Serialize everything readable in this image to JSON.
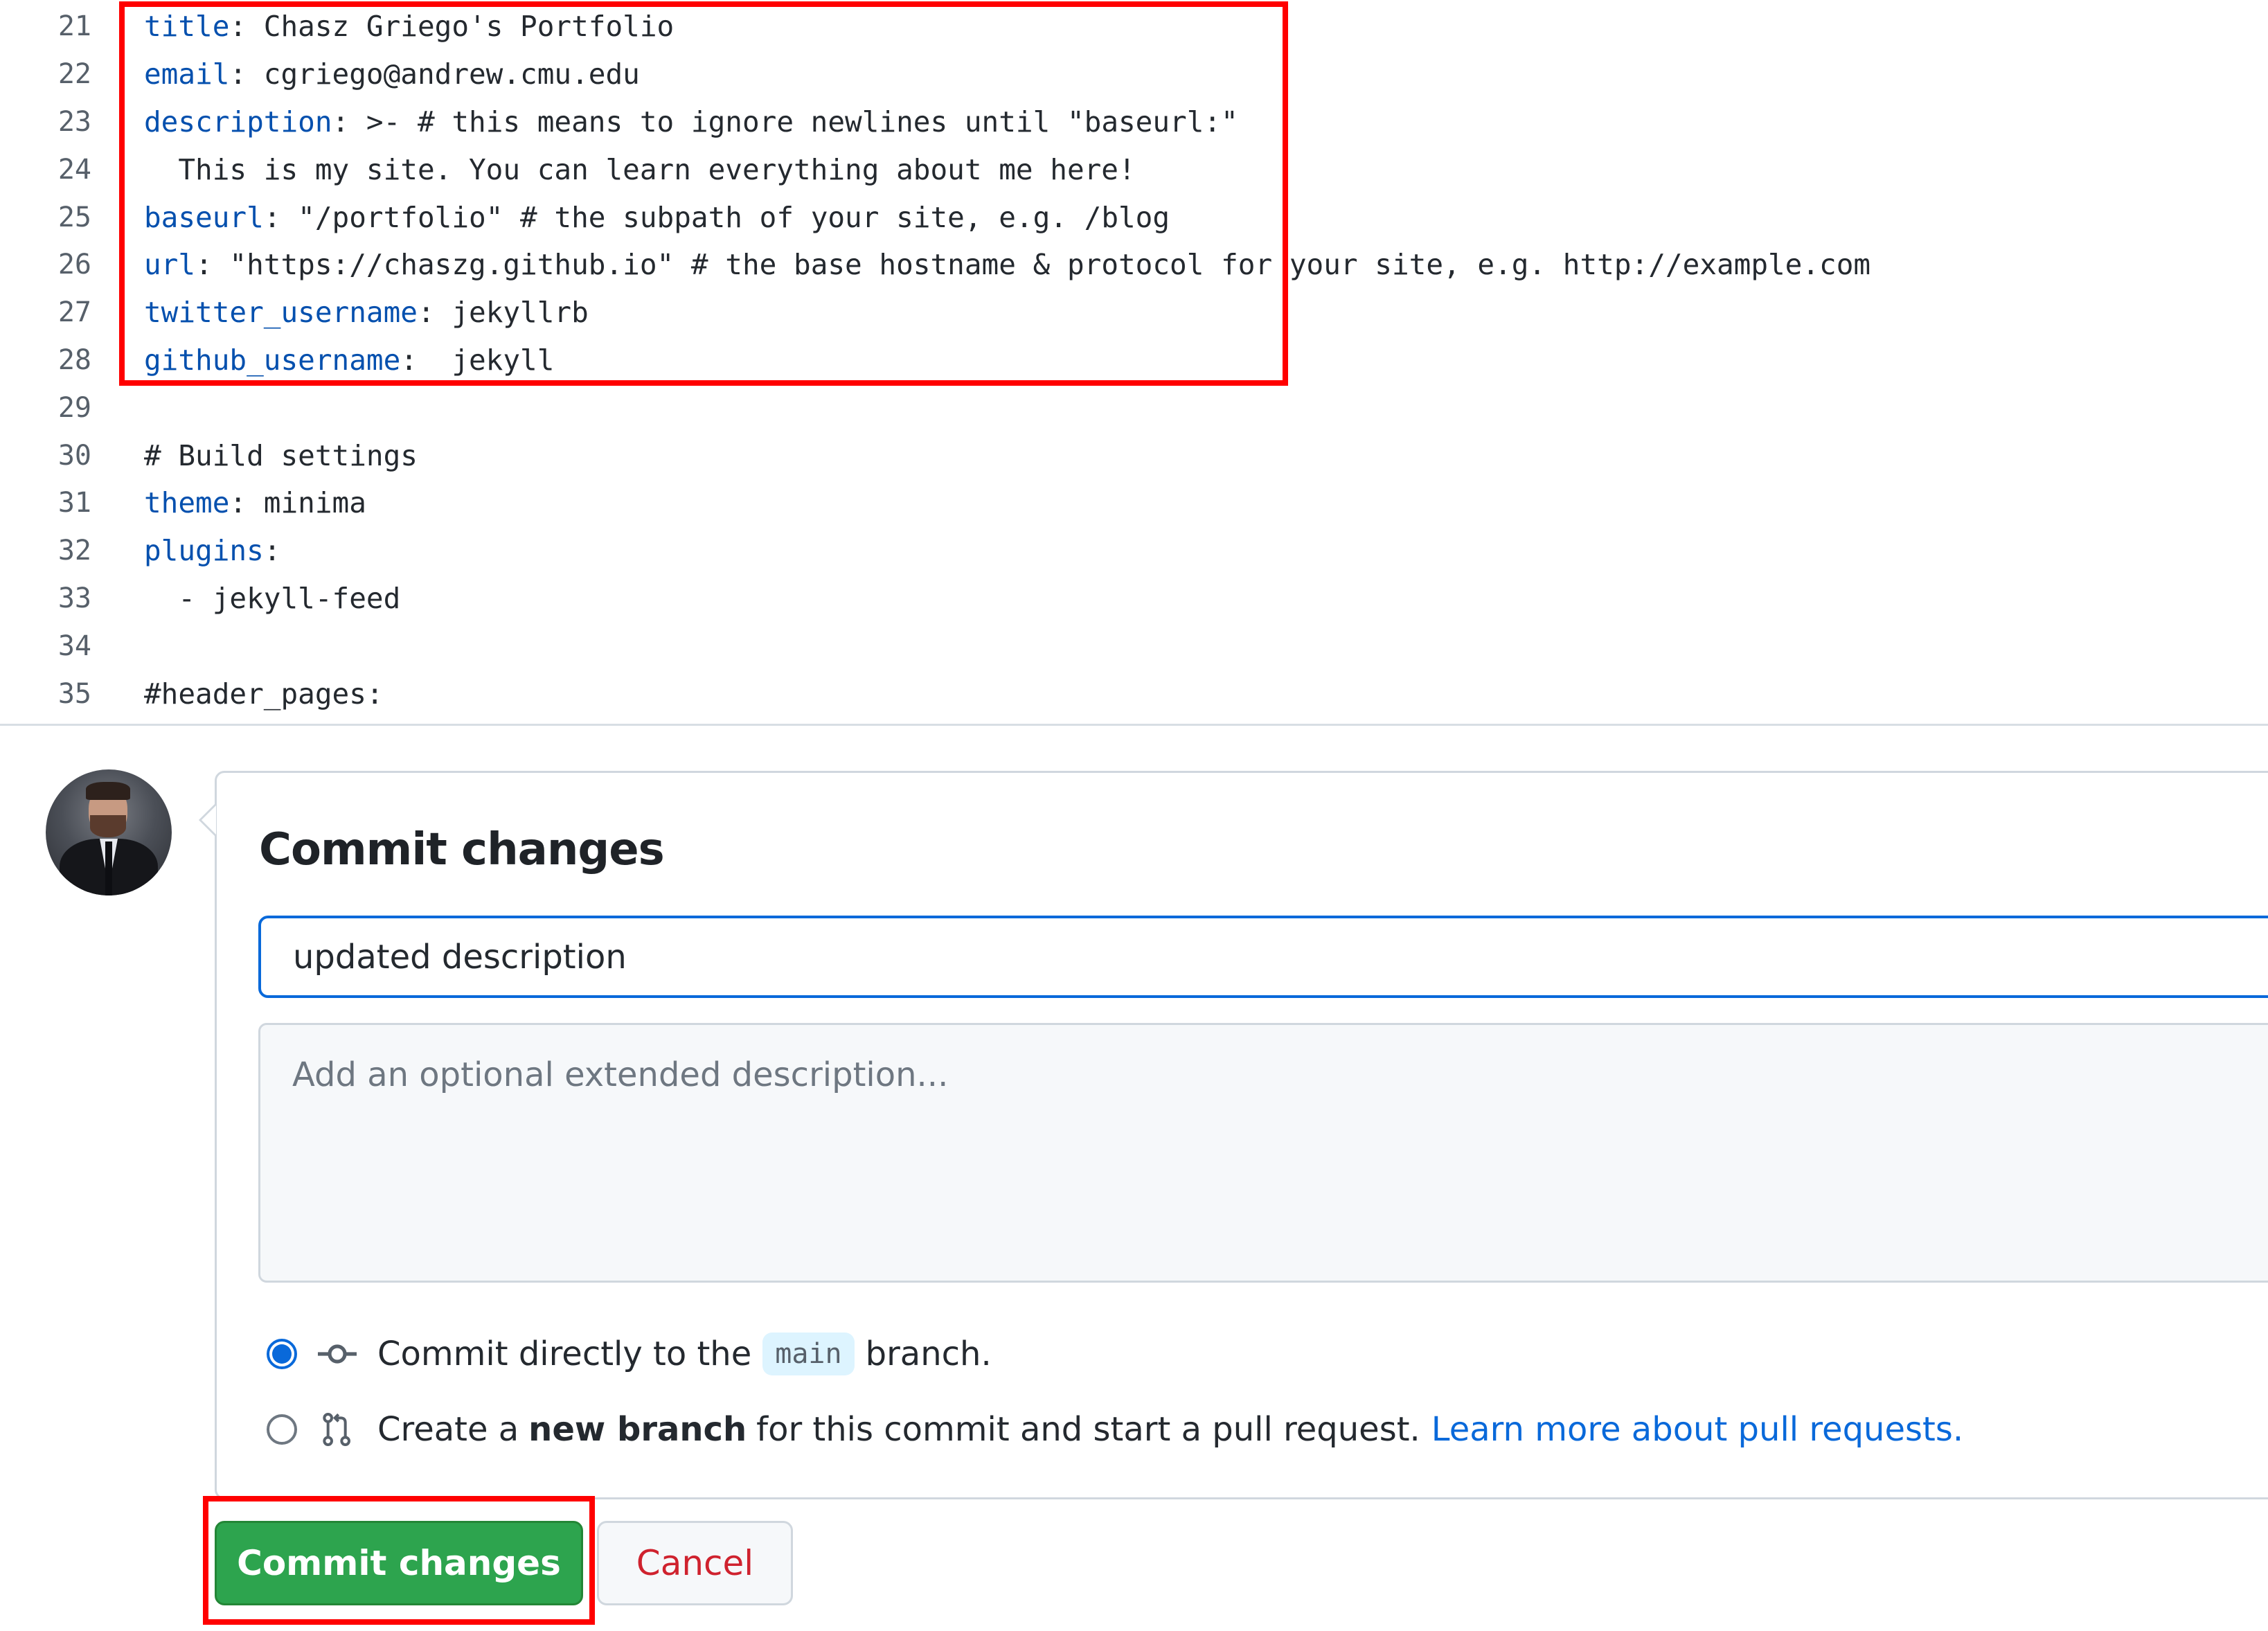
{
  "editor": {
    "lines": [
      {
        "num": "21",
        "key": "title",
        "rest": ": Chasz Griego's Portfolio"
      },
      {
        "num": "22",
        "key": "email",
        "rest": ": cgriego@andrew.cmu.edu"
      },
      {
        "num": "23",
        "key": "description",
        "rest": ": >- # this means to ignore newlines until \"baseurl:\""
      },
      {
        "num": "24",
        "key": "",
        "rest": "  This is my site. You can learn everything about me here!"
      },
      {
        "num": "25",
        "key": "baseurl",
        "rest": ": \"/portfolio\" # the subpath of your site, e.g. /blog"
      },
      {
        "num": "26",
        "key": "url",
        "rest": ": \"https://chaszg.github.io\" # the base hostname & protocol for your site, e.g. http://example.com"
      },
      {
        "num": "27",
        "key": "twitter_username",
        "rest": ": jekyllrb"
      },
      {
        "num": "28",
        "key": "github_username",
        "rest": ":  jekyll"
      },
      {
        "num": "29",
        "key": "",
        "rest": ""
      },
      {
        "num": "30",
        "key": "",
        "rest": "# Build settings"
      },
      {
        "num": "31",
        "key": "theme",
        "rest": ": minima"
      },
      {
        "num": "32",
        "key": "plugins",
        "rest": ":"
      },
      {
        "num": "33",
        "key": "",
        "rest": "  - jekyll-feed"
      },
      {
        "num": "34",
        "key": "",
        "rest": ""
      },
      {
        "num": "35",
        "key": "",
        "rest": "#header_pages:"
      }
    ]
  },
  "commit": {
    "heading": "Commit changes",
    "message_value": "updated description",
    "description_placeholder": "Add an optional extended description...",
    "options": {
      "direct": {
        "prefix": "Commit directly to the",
        "branch": "main",
        "suffix": "branch.",
        "selected": true
      },
      "new_branch": {
        "prefix": "Create a",
        "bold": "new branch",
        "suffix": "for this commit and start a pull request.",
        "link": "Learn more about pull requests.",
        "selected": false
      }
    },
    "commit_button": "Commit changes",
    "cancel_button": "Cancel"
  },
  "colors": {
    "highlight_box": "#ff0000",
    "accent_blue": "#0969da",
    "commit_green": "#2da44e",
    "cancel_red": "#cf222e",
    "yaml_key": "#0550ae"
  }
}
